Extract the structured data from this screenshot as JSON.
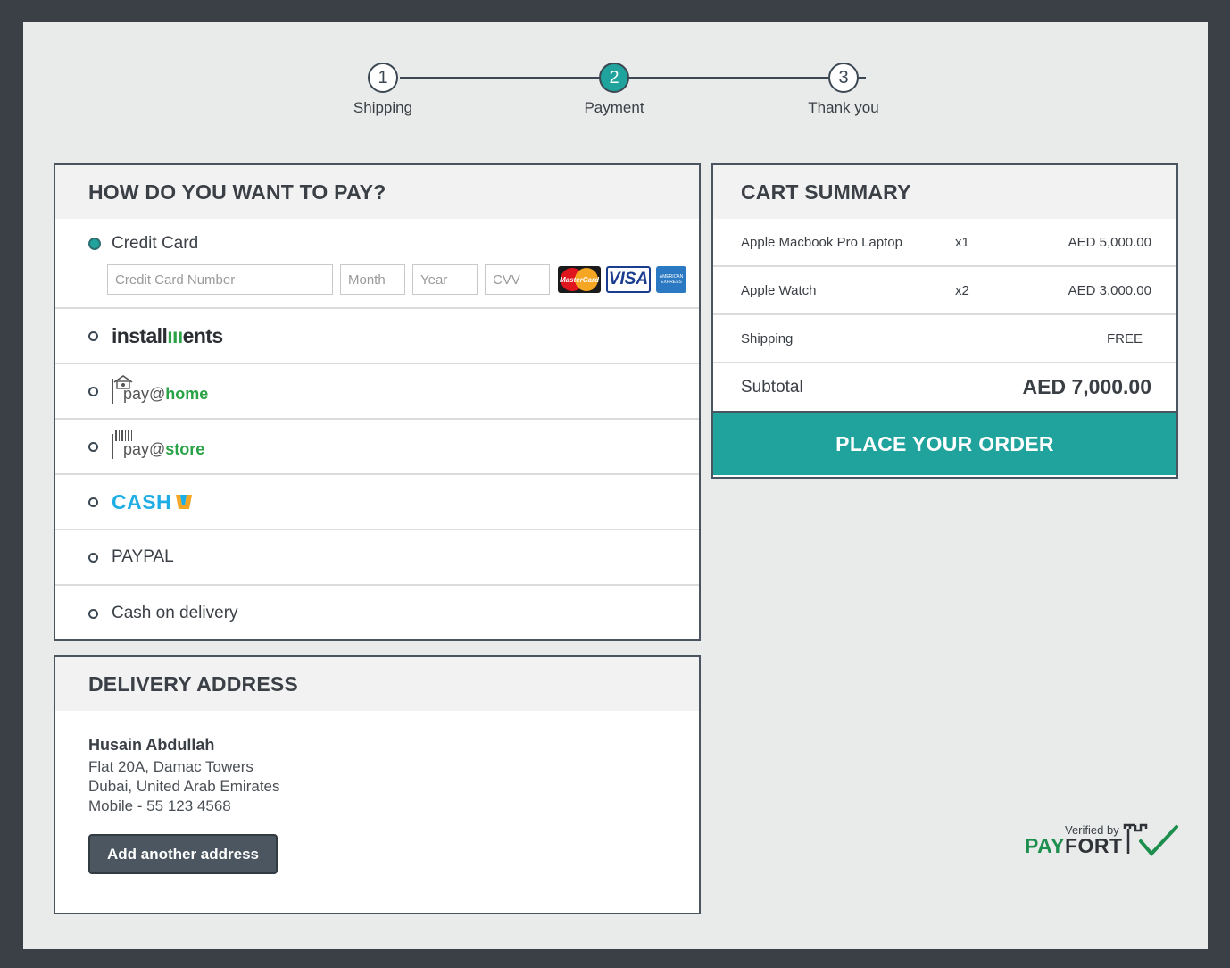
{
  "steps": [
    {
      "number": "1",
      "label": "Shipping",
      "active": false
    },
    {
      "number": "2",
      "label": "Payment",
      "active": true
    },
    {
      "number": "3",
      "label": "Thank you",
      "active": false
    }
  ],
  "payment": {
    "title": "HOW DO YOU WANT TO PAY?",
    "credit_card": {
      "label": "Credit Card",
      "selected": true,
      "number_placeholder": "Credit Card Number",
      "month_placeholder": "Month",
      "year_placeholder": "Year",
      "cvv_placeholder": "CVV",
      "cards": {
        "mastercard": "MasterCard",
        "visa": "VISA",
        "amex": "AMERICAN EXPRESS"
      }
    },
    "options": {
      "installments": {
        "pre": "install",
        "mid": "m",
        "post": "ents"
      },
      "pay_home": {
        "pre": "pay@",
        "post": "home"
      },
      "pay_store": {
        "pre": "pay@",
        "post": "store"
      },
      "cashu": "CASH",
      "paypal": "PAYPAL",
      "cod": "Cash on delivery"
    }
  },
  "delivery": {
    "title": "DELIVERY ADDRESS",
    "name": "Husain Abdullah",
    "line1": "Flat 20A, Damac Towers",
    "line2": "Dubai, United Arab Emirates",
    "phone": "Mobile - 55 123 4568",
    "add_button": "Add another address"
  },
  "cart": {
    "title": "CART SUMMARY",
    "items": [
      {
        "name": "Apple Macbook Pro Laptop",
        "qty": "x1",
        "price": "AED 5,000.00"
      },
      {
        "name": "Apple Watch",
        "qty": "x2",
        "price": "AED 3,000.00"
      }
    ],
    "shipping_label": "Shipping",
    "shipping_value": "FREE",
    "subtotal_label": "Subtotal",
    "subtotal_value": "AED 7,000.00",
    "order_button": "PLACE YOUR ORDER"
  },
  "payfort": {
    "verified": "Verified by",
    "brand_a": "PAY",
    "brand_b": "FORT"
  },
  "colors": {
    "accent": "#20a39c",
    "dark": "#3b4047",
    "background": "#e9eaea"
  }
}
